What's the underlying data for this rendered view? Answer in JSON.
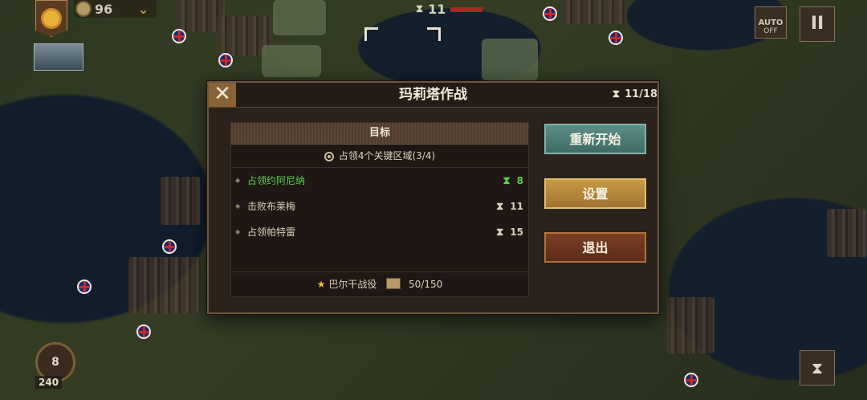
{
  "hud": {
    "coins": "96",
    "turn_counter": "11",
    "auto_label": "AUTO",
    "auto_state": "OFF",
    "pause_symbol": "II",
    "level": "8",
    "money": "240",
    "corner_icon": "hourglass-icon"
  },
  "dialog": {
    "title": "玛莉塔作战",
    "turns": "11/18",
    "close_symbol": "✕",
    "objectives_header": "目标",
    "main_objective": "占领4个关键区域(3/4)",
    "objectives": [
      {
        "label": "占领约阿尼纳",
        "turns": "8",
        "completed": true
      },
      {
        "label": "击败布莱梅",
        "turns": "11",
        "completed": false
      },
      {
        "label": "占领帕特雷",
        "turns": "15",
        "completed": false
      }
    ],
    "campaign": "巴尔干战役",
    "campaign_progress": "50/150",
    "buttons": {
      "restart": "重新开始",
      "settings": "设置",
      "quit": "退出"
    }
  },
  "colors": {
    "completed": "#5bd04a",
    "restart": "#4a7c77",
    "settings": "#b8883b",
    "quit": "#6b341d"
  }
}
